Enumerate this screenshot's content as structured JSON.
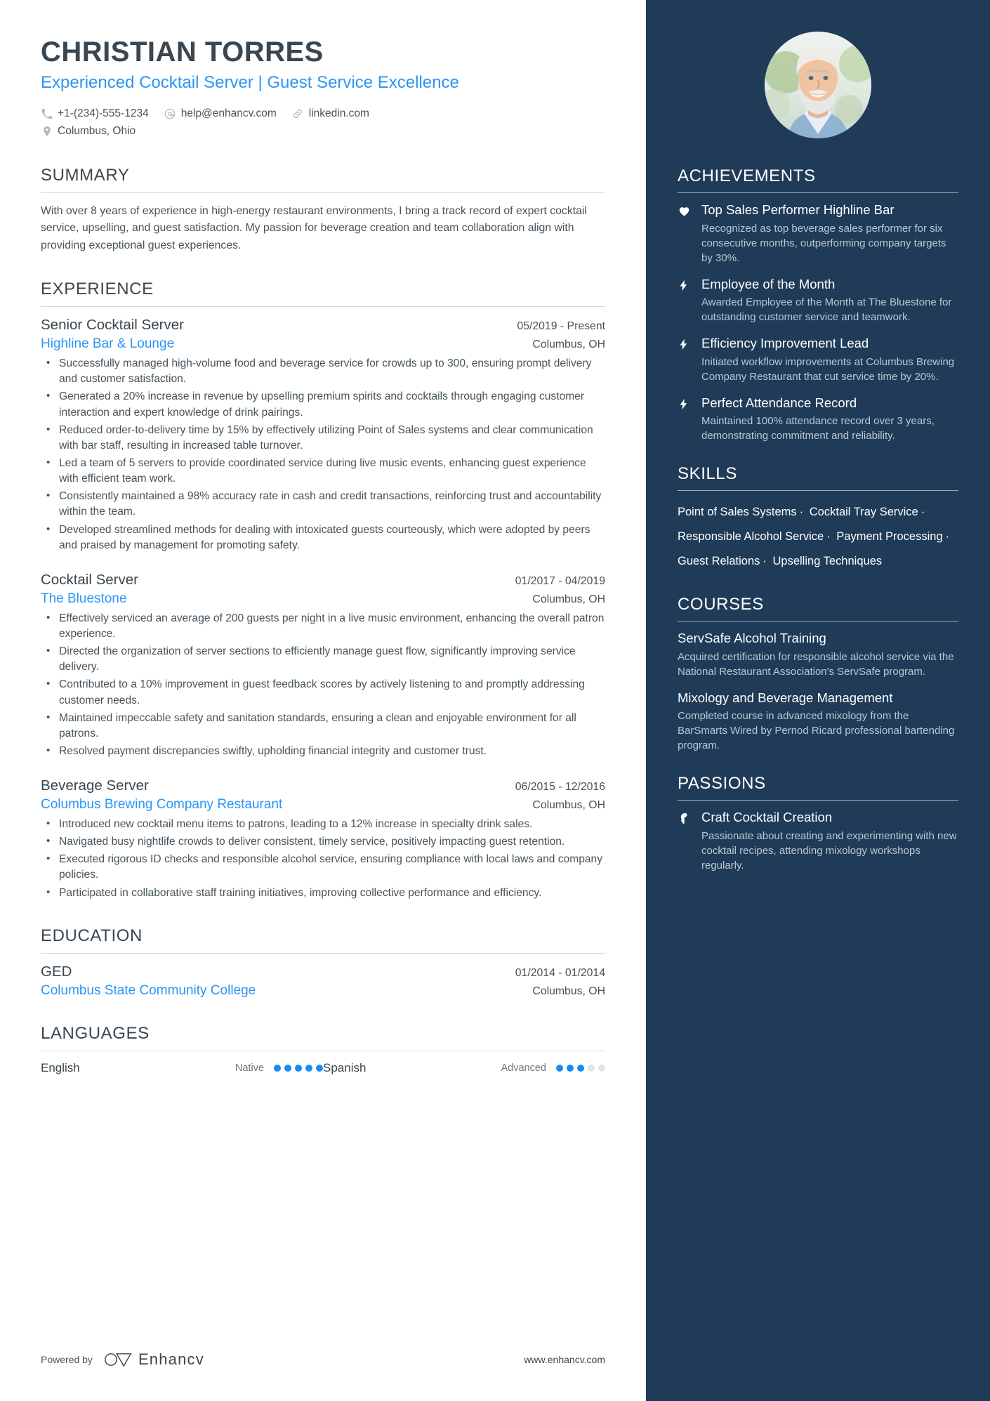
{
  "header": {
    "name": "CHRISTIAN TORRES",
    "headline": "Experienced Cocktail Server | Guest Service Excellence",
    "contacts": [
      {
        "icon": "phone-icon",
        "text": "+1-(234)-555-1234"
      },
      {
        "icon": "email-icon",
        "text": "help@enhancv.com"
      },
      {
        "icon": "link-icon",
        "text": "linkedin.com"
      }
    ],
    "location": {
      "icon": "location-pin-icon",
      "text": "Columbus, Ohio"
    }
  },
  "summary": {
    "title": "SUMMARY",
    "text": "With over 8 years of experience in high-energy restaurant environments, I bring a track record of expert cocktail service, upselling, and guest satisfaction. My passion for beverage creation and team collaboration align with providing exceptional guest experiences."
  },
  "experience": {
    "title": "EXPERIENCE",
    "jobs": [
      {
        "title": "Senior Cocktail Server",
        "dates": "05/2019 - Present",
        "company": "Highline Bar & Lounge",
        "location": "Columbus, OH",
        "bullets": [
          "Successfully managed high-volume food and beverage service for crowds up to 300, ensuring prompt delivery and customer satisfaction.",
          "Generated a 20% increase in revenue by upselling premium spirits and cocktails through engaging customer interaction and expert knowledge of drink pairings.",
          "Reduced order-to-delivery time by 15% by effectively utilizing Point of Sales systems and clear communication with bar staff, resulting in increased table turnover.",
          "Led a team of 5 servers to provide coordinated service during live music events, enhancing guest experience with efficient team work.",
          "Consistently maintained a 98% accuracy rate in cash and credit transactions, reinforcing trust and accountability within the team.",
          "Developed streamlined methods for dealing with intoxicated guests courteously, which were adopted by peers and praised by management for promoting safety."
        ]
      },
      {
        "title": "Cocktail Server",
        "dates": "01/2017 - 04/2019",
        "company": "The Bluestone",
        "location": "Columbus, OH",
        "bullets": [
          "Effectively serviced an average of 200 guests per night in a live music environment, enhancing the overall patron experience.",
          "Directed the organization of server sections to efficiently manage guest flow, significantly improving service delivery.",
          "Contributed to a 10% improvement in guest feedback scores by actively listening to and promptly addressing customer needs.",
          "Maintained impeccable safety and sanitation standards, ensuring a clean and enjoyable environment for all patrons.",
          "Resolved payment discrepancies swiftly, upholding financial integrity and customer trust."
        ]
      },
      {
        "title": "Beverage Server",
        "dates": "06/2015 - 12/2016",
        "company": "Columbus Brewing Company Restaurant",
        "location": "Columbus, OH",
        "bullets": [
          "Introduced new cocktail menu items to patrons, leading to a 12% increase in specialty drink sales.",
          "Navigated busy nightlife crowds to deliver consistent, timely service, positively impacting guest retention.",
          "Executed rigorous ID checks and responsible alcohol service, ensuring compliance with local laws and company policies.",
          "Participated in collaborative staff training initiatives, improving collective performance and efficiency."
        ]
      }
    ]
  },
  "education": {
    "title": "EDUCATION",
    "items": [
      {
        "degree": "GED",
        "dates": "01/2014 - 01/2014",
        "school": "Columbus State Community College",
        "location": "Columbus, OH"
      }
    ]
  },
  "languages": {
    "title": "LANGUAGES",
    "items": [
      {
        "name": "English",
        "level": "Native",
        "filled": 5,
        "total": 5
      },
      {
        "name": "Spanish",
        "level": "Advanced",
        "filled": 3,
        "total": 5
      }
    ]
  },
  "footer": {
    "powered_by": "Powered by",
    "brand": "Enhancv",
    "website": "www.enhancv.com"
  },
  "achievements": {
    "title": "ACHIEVEMENTS",
    "items": [
      {
        "icon": "heart-icon",
        "title": "Top Sales Performer Highline Bar",
        "desc": "Recognized as top beverage sales performer for six consecutive months, outperforming company targets by 30%."
      },
      {
        "icon": "bolt-icon",
        "title": "Employee of the Month",
        "desc": "Awarded Employee of the Month at The Bluestone for outstanding customer service and teamwork."
      },
      {
        "icon": "bolt-icon",
        "title": "Efficiency Improvement Lead",
        "desc": "Initiated workflow improvements at Columbus Brewing Company Restaurant that cut service time by 20%."
      },
      {
        "icon": "bolt-icon",
        "title": "Perfect Attendance Record",
        "desc": "Maintained 100% attendance record over 3 years, demonstrating commitment and reliability."
      }
    ]
  },
  "skills": {
    "title": "SKILLS",
    "items": [
      "Point of Sales Systems",
      "Cocktail Tray Service",
      "Responsible Alcohol Service",
      "Payment Processing",
      "Guest Relations",
      "Upselling Techniques"
    ],
    "separator": "·"
  },
  "courses": {
    "title": "COURSES",
    "items": [
      {
        "title": "ServSafe Alcohol Training",
        "desc": "Acquired certification for responsible alcohol service via the National Restaurant Association's ServSafe program."
      },
      {
        "title": "Mixology and Beverage Management",
        "desc": "Completed course in advanced mixology from the BarSmarts Wired by Pernod Ricard professional bartending program."
      }
    ]
  },
  "passions": {
    "title": "PASSIONS",
    "items": [
      {
        "icon": "head-idea-icon",
        "title": "Craft Cocktail Creation",
        "desc": "Passionate about creating and experimenting with new cocktail recipes, attending mixology workshops regularly."
      }
    ]
  },
  "colors": {
    "accent_blue": "#2b95f5",
    "sidebar_navy": "#1f3b58",
    "text_dark": "#3a4750",
    "text_body": "#46535c"
  }
}
